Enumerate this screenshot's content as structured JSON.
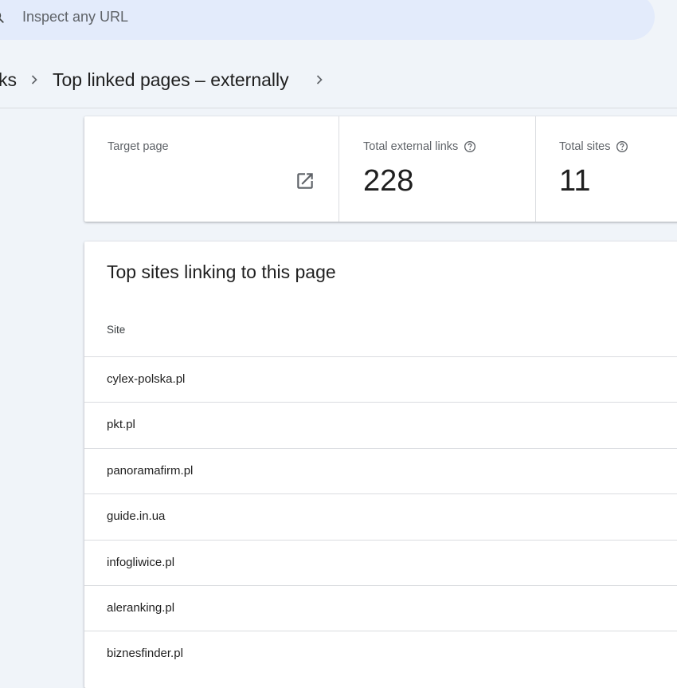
{
  "search": {
    "placeholder": "Inspect any URL"
  },
  "breadcrumb": {
    "previous": "ks",
    "current": "Top linked pages – externally"
  },
  "metrics": {
    "target_page": {
      "label": "Target page",
      "icon": "open-in-new-icon"
    },
    "total_external_links": {
      "label": "Total external links",
      "value": "228"
    },
    "total_sites": {
      "label": "Total sites",
      "value": "11"
    }
  },
  "table": {
    "title": "Top sites linking to this page",
    "columns": [
      "Site"
    ],
    "rows": [
      "cylex-polska.pl",
      "pkt.pl",
      "panoramafirm.pl",
      "guide.in.ua",
      "infogliwice.pl",
      "aleranking.pl",
      "biznesfinder.pl"
    ]
  },
  "colors": {
    "background": "#f0f4f9",
    "search_bg": "#e3ebfb",
    "card_bg": "#ffffff",
    "divider": "#dadce0"
  }
}
